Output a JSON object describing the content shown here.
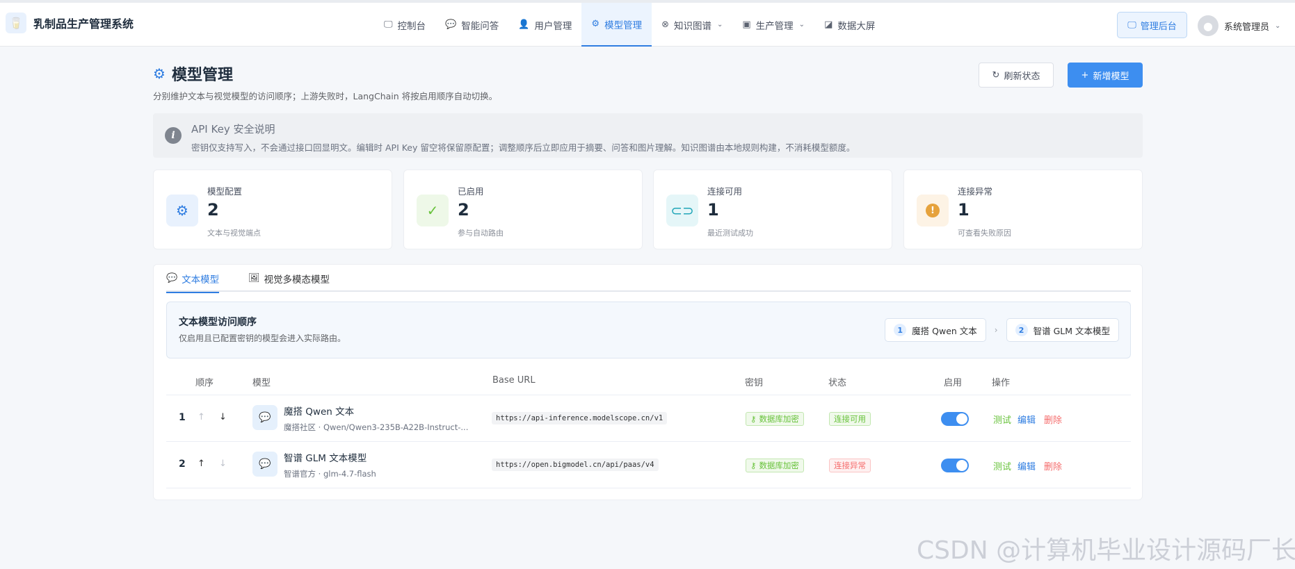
{
  "app": {
    "title": "乳制品生产管理系统"
  },
  "nav": [
    {
      "label": "控制台",
      "icon": "monitor-icon"
    },
    {
      "label": "智能问答",
      "icon": "chat-icon"
    },
    {
      "label": "用户管理",
      "icon": "user-icon"
    },
    {
      "label": "模型管理",
      "icon": "gear-icon",
      "active": true
    },
    {
      "label": "知识图谱",
      "icon": "graph-icon",
      "dropdown": true
    },
    {
      "label": "生产管理",
      "icon": "box-icon",
      "dropdown": true
    },
    {
      "label": "数据大屏",
      "icon": "chart-icon"
    }
  ],
  "header_actions": {
    "admin_label": "管理后台",
    "user_name": "系统管理员"
  },
  "page": {
    "title": "模型管理",
    "subtitle": "分别维护文本与视觉模型的访问顺序；上游失败时，LangChain 将按启用顺序自动切换。",
    "refresh_label": "刷新状态",
    "add_label": "新增模型"
  },
  "alert": {
    "title": "API Key 安全说明",
    "desc": "密钥仅支持写入，不会通过接口回显明文。编辑时 API Key 留空将保留原配置；调整顺序后立即应用于摘要、问答和图片理解。知识图谱由本地规则构建，不消耗模型额度。"
  },
  "stats": [
    {
      "label": "模型配置",
      "value": "2",
      "note": "文本与视觉端点",
      "color": "#2f7de1"
    },
    {
      "label": "已启用",
      "value": "2",
      "note": "参与自动路由",
      "color": "#67c23a"
    },
    {
      "label": "连接可用",
      "value": "1",
      "note": "最近测试成功",
      "color": "#20a6b8"
    },
    {
      "label": "连接异常",
      "value": "1",
      "note": "可查看失败原因",
      "color": "#e6a23c"
    }
  ],
  "tabs": [
    {
      "label": "文本模型",
      "active": true
    },
    {
      "label": "视觉多模态模型",
      "active": false
    }
  ],
  "order": {
    "title": "文本模型访问顺序",
    "subtitle": "仅启用且已配置密钥的模型会进入实际路由。",
    "chips": [
      {
        "num": "1",
        "label": "魔搭 Qwen 文本"
      },
      {
        "num": "2",
        "label": "智谱 GLM 文本模型"
      }
    ]
  },
  "table": {
    "headers": {
      "order": "顺序",
      "model": "模型",
      "url": "Base URL",
      "key": "密钥",
      "status": "状态",
      "enabled": "启用",
      "actions": "操作"
    },
    "rows": [
      {
        "order": "1",
        "name": "魔搭 Qwen 文本",
        "meta": "魔搭社区 · Qwen/Qwen3-235B-A22B-Instruct-...",
        "url": "https://api-inference.modelscope.cn/v1",
        "key": "数据库加密",
        "status": "连接可用",
        "status_type": "ok",
        "enabled": true
      },
      {
        "order": "2",
        "name": "智谱 GLM 文本模型",
        "meta": "智谱官方 · glm-4.7-flash",
        "url": "https://open.bigmodel.cn/api/paas/v4",
        "key": "数据库加密",
        "status": "连接异常",
        "status_type": "error",
        "enabled": true
      }
    ],
    "actions": {
      "test": "测试",
      "edit": "编辑",
      "delete": "删除"
    }
  },
  "colors": {
    "accent": "#2f7de1",
    "success": "#67c23a",
    "danger": "#f56c6c"
  },
  "watermark": "CSDN @计算机毕业设计源码厂长"
}
